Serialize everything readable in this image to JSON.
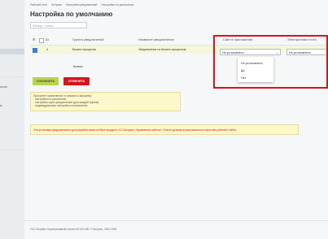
{
  "sidebar": {
    "items": [
      {
        "label": "осов"
      },
      {
        "label": "ы"
      }
    ]
  },
  "breadcrumb": [
    "Рабочий стол",
    "Битрикс",
    "Настройки уведомлений",
    "Настройка по умолчанию"
  ],
  "page_title": "Настройка по умолчанию",
  "filter": {
    "placeholder": "Фильтр + поиск"
  },
  "table": {
    "headers": [
      "ID",
      "Группа уведомлений",
      "Название уведомления",
      "Сайт в приложении",
      "Электронная почта"
    ],
    "row": {
      "id": "4",
      "group": "Бизнес-процессы",
      "name": "Уведомление из бизнес-процессов"
    },
    "row2": {
      "group": "Бизнес"
    },
    "site_value": "Не установлено",
    "email_value": "Не установлено"
  },
  "dropdown": {
    "options": [
      "Не установлено",
      "Да",
      "Нет"
    ]
  },
  "buttons": {
    "save": "СОХРАНИТЬ",
    "cancel": "ОТМЕНИТЬ"
  },
  "info": {
    "lines": [
      "Приоритет применения от низшего к высшему:",
      "- настройки по умолчанию",
      "- настройки групп уведомлений (для каждой группы)",
      "- индивидуальные настройки пользователя"
    ]
  },
  "warning": "Эта установка предназначена для разработчиков на базе продукта «1С-Битрикс: Управление сайтом». Она не должна использоваться в качестве рабочего сайта.",
  "footer": "©1С-Битрикс: Корпоративный портал 25.100.400. © Битрикс, 2002-2025",
  "colors": {
    "accent": "#d6141e",
    "save": "#b8d44c",
    "checkbox": "#3b7bd6"
  }
}
